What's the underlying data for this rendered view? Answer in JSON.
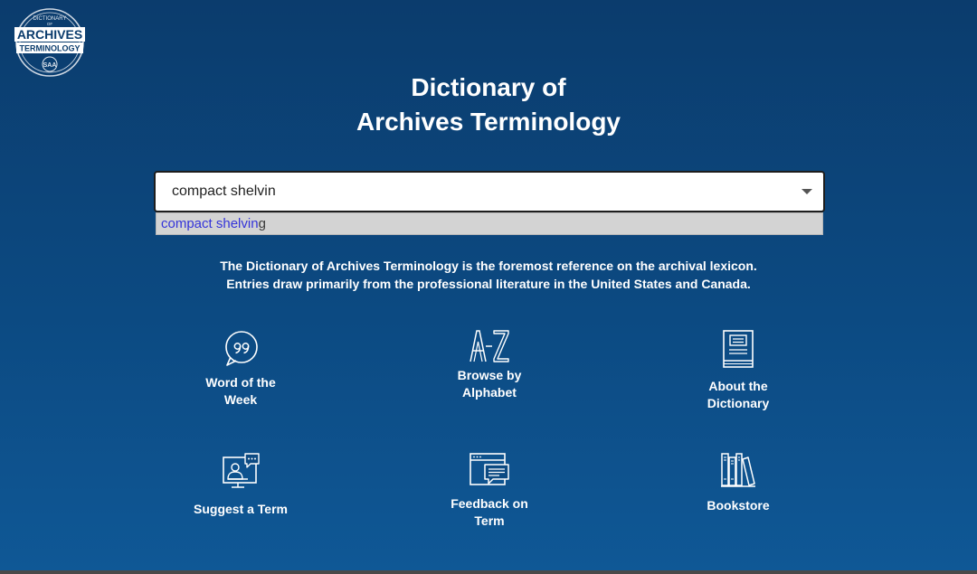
{
  "logo": {
    "top_text": "DICTIONARY",
    "of_text": "OF",
    "line1": "ARCHIVES",
    "line2": "TERMINOLOGY",
    "badge": "SAA"
  },
  "header": {
    "title_line1": "Dictionary of",
    "title_line2": "Archives Terminology"
  },
  "search": {
    "value": "compact shelvin",
    "suggestion_match": "compact shelvin",
    "suggestion_rest": "g"
  },
  "description": {
    "line1": "The Dictionary of Archives Terminology is the foremost reference on the archival lexicon.",
    "line2": "Entries draw primarily from the professional literature in the United States and Canada."
  },
  "tiles": [
    {
      "icon": "quote-bubble-icon",
      "line1": "Word of the",
      "line2": "Week"
    },
    {
      "icon": "a-z-icon",
      "line1": "Browse by",
      "line2": "Alphabet"
    },
    {
      "icon": "book-icon",
      "line1": "About the",
      "line2": "Dictionary"
    },
    {
      "icon": "video-chat-icon",
      "line1": "Suggest a Term",
      "line2": ""
    },
    {
      "icon": "feedback-window-icon",
      "line1": "Feedback on",
      "line2": "Term"
    },
    {
      "icon": "bookshelf-icon",
      "line1": "Bookstore",
      "line2": ""
    }
  ],
  "colors": {
    "background_top": "#0b3c6d",
    "background_bottom": "#0f5896",
    "suggestion_highlight": "#3434d9",
    "suggestion_bg": "#d3d3d3"
  }
}
